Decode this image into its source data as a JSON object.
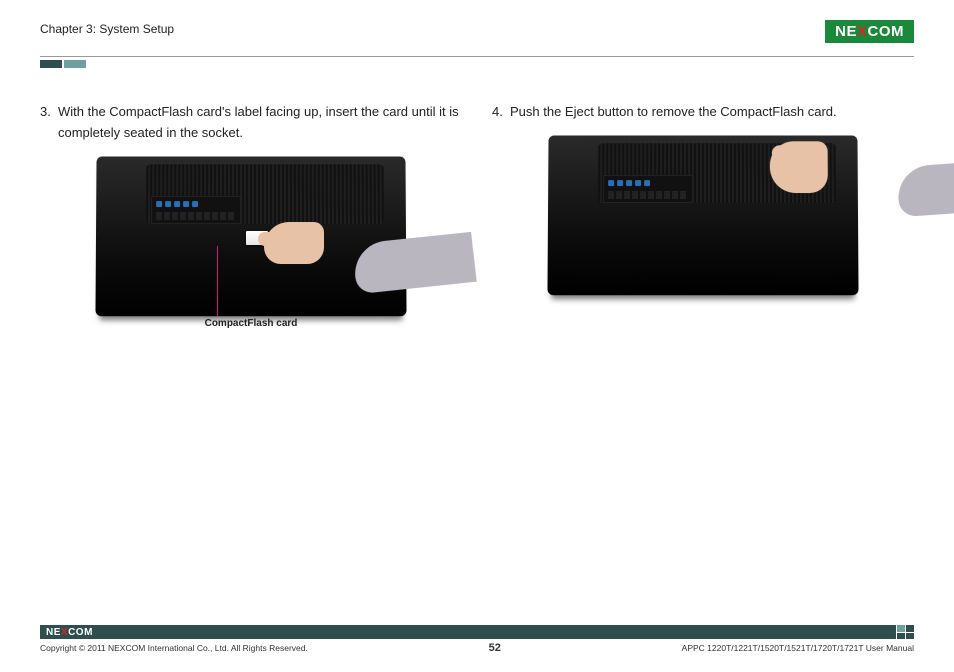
{
  "header": {
    "chapter": "Chapter 3: System Setup",
    "logo_pre": "NE",
    "logo_x": "X",
    "logo_post": "COM"
  },
  "steps": {
    "s3_num": "3.",
    "s3_text": "With the CompactFlash card's label facing up, insert the card until it is completely seated in the socket.",
    "s3_callout": "CompactFlash card",
    "s4_num": "4.",
    "s4_text": "Push the Eject button to remove the CompactFlash card."
  },
  "footer": {
    "logo_pre": "NE",
    "logo_x": "X",
    "logo_post": "COM",
    "copyright": "Copyright © 2011 NEXCOM International Co., Ltd. All Rights Reserved.",
    "page": "52",
    "doc": "APPC 1220T/1221T/1520T/1521T/1720T/1721T User Manual"
  }
}
